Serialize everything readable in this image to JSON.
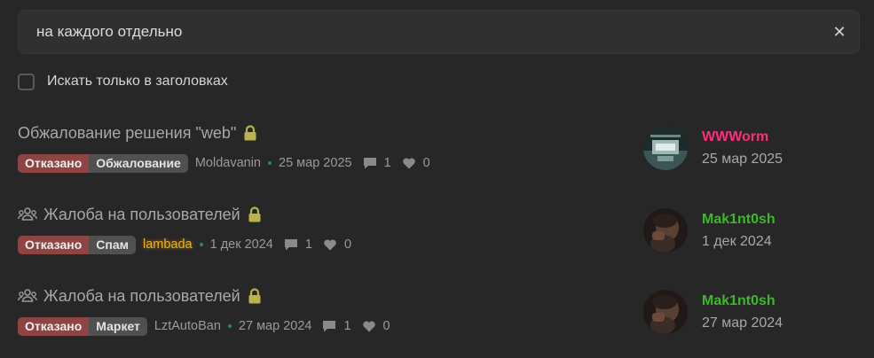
{
  "search": {
    "value": "на каждого отдельно",
    "clear_icon": "close-icon"
  },
  "filter": {
    "titles_only_label": "Искать только в заголовках",
    "checked": false
  },
  "colors": {
    "refused": "#8f4444",
    "category": "#505050",
    "pink_user": "#ff2d7a",
    "green_user": "#3cb82a",
    "gold_author": "#f0b020"
  },
  "threads": [
    {
      "title": "Обжалование решения \"web\"",
      "icon": "lock-icon",
      "status_tag": "Отказано",
      "category_tag": "Обжалование",
      "author": "Moldavanin",
      "date": "25 мар 2025",
      "replies": "1",
      "likes": "0",
      "last_user": "WWWorm",
      "last_date": "25 мар 2025"
    },
    {
      "title": "Жалоба на пользователей",
      "icon": "group-icon",
      "status_tag": "Отказано",
      "category_tag": "Спам",
      "author": "lambada",
      "date": "1 дек 2024",
      "replies": "1",
      "likes": "0",
      "last_user": "Mak1nt0sh",
      "last_date": "1 дек 2024"
    },
    {
      "title": "Жалоба на пользователей",
      "icon": "group-icon",
      "status_tag": "Отказано",
      "category_tag": "Маркет",
      "author": "LztAutoBan",
      "date": "27 мар 2024",
      "replies": "1",
      "likes": "0",
      "last_user": "Mak1nt0sh",
      "last_date": "27 мар 2024"
    }
  ]
}
